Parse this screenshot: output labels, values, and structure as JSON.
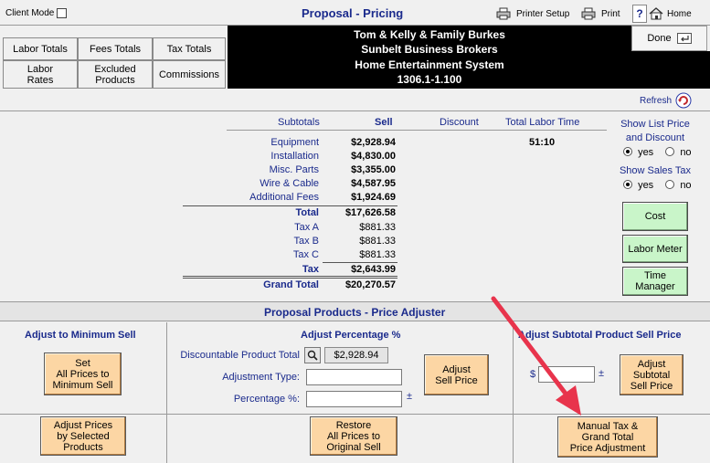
{
  "header": {
    "client_mode_label": "Client Mode",
    "title": "Proposal - Pricing",
    "printer_setup": "Printer Setup",
    "print": "Print",
    "help": "?",
    "home": "Home",
    "done": "Done"
  },
  "tabs": {
    "labor_totals": "Labor Totals",
    "fees_totals": "Fees Totals",
    "tax_totals": "Tax Totals",
    "labor_rates": "Labor\nRates",
    "excluded_products": "Excluded\nProducts",
    "commissions": "Commissions"
  },
  "proposal_info": {
    "client": "Tom & Kelly & Family Burkes",
    "company": "Sunbelt Business Brokers",
    "project": "Home Entertainment System",
    "number": "1306.1-1.100"
  },
  "refresh_label": "Refresh",
  "summary": {
    "col_subtotals": "Subtotals",
    "col_sell": "Sell",
    "col_discount": "Discount",
    "col_total_labor_time": "Total Labor Time",
    "labor_time": "51:10",
    "rows": [
      {
        "label": "Equipment",
        "value": "$2,928.94"
      },
      {
        "label": "Installation",
        "value": "$4,830.00"
      },
      {
        "label": "Misc. Parts",
        "value": "$3,355.00"
      },
      {
        "label": "Wire & Cable",
        "value": "$4,587.95"
      },
      {
        "label": "Additional Fees",
        "value": "$1,924.69"
      }
    ],
    "total_label": "Total",
    "total_value": "$17,626.58",
    "tax_rows": [
      {
        "label": "Tax A",
        "value": "$881.33"
      },
      {
        "label": "Tax B",
        "value": "$881.33"
      },
      {
        "label": "Tax C",
        "value": "$881.33"
      }
    ],
    "tax_label": "Tax",
    "tax_value": "$2,643.99",
    "grand_total_label": "Grand Total",
    "grand_total_value": "$20,270.57"
  },
  "options": {
    "show_list_price_label": "Show List Price\nand Discount",
    "show_sales_tax_label": "Show Sales Tax",
    "yes": "yes",
    "no": "no",
    "cost": "Cost",
    "labor_meter": "Labor Meter",
    "time_manager": "Time\nManager"
  },
  "adjuster": {
    "title": "Proposal Products - Price Adjuster",
    "min_sell_title": "Adjust to Minimum Sell",
    "set_all_min": "Set\nAll Prices to\nMinimum Sell",
    "pct_title": "Adjust Percentage %",
    "discountable_label": "Discountable Product Total",
    "discountable_value": "$2,928.94",
    "adjustment_type_label": "Adjustment Type:",
    "adjustment_type_value": "",
    "percentage_label": "Percentage %:",
    "percentage_value": "",
    "adjust_sell_price": "Adjust\nSell Price",
    "subtotal_title": "Adjust Subtotal Product Sell Price",
    "dollar": "$",
    "subtotal_value": "",
    "plusminus": "±",
    "adjust_subtotal": "Adjust\nSubtotal\nSell Price",
    "adjust_by_selected": "Adjust Prices\nby Selected\nProducts",
    "restore_all": "Restore\nAll Prices to\nOriginal Sell",
    "manual_tax": "Manual Tax &\nGrand Total\nPrice Adjustment"
  },
  "colors": {
    "title_blue": "#1a2a8c",
    "green_button": "#c9f5c9",
    "orange_button": "#fcd6a4",
    "arrow": "#e8344c"
  }
}
